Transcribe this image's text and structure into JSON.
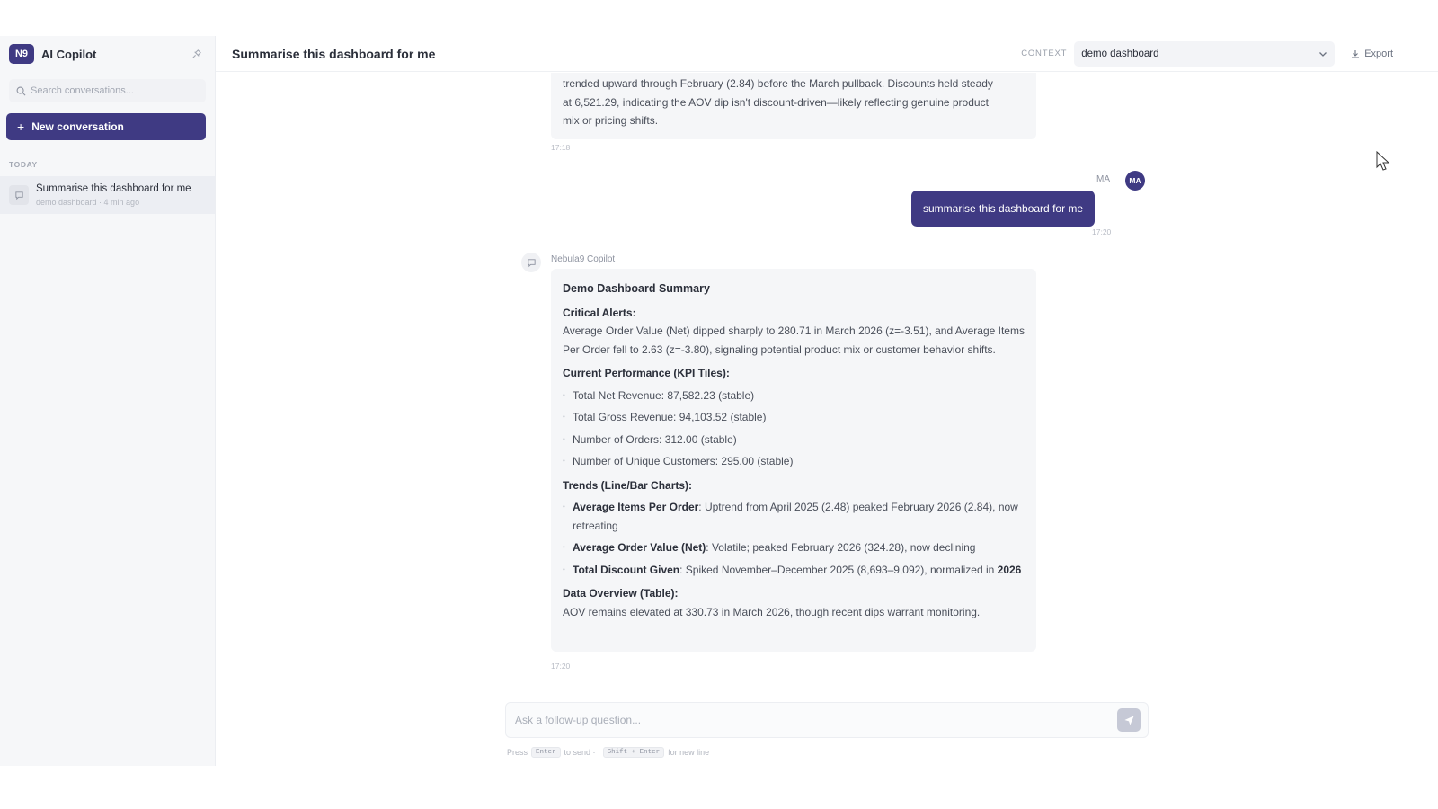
{
  "sidebar": {
    "brand_badge": "N9",
    "brand_name": "AI Copilot",
    "search_placeholder": "Search conversations...",
    "new_conversation_label": "New conversation",
    "section_today": "TODAY",
    "conversations": [
      {
        "title": "Summarise this dashboard for me",
        "meta": "demo dashboard · 4 min ago"
      }
    ]
  },
  "header": {
    "title": "Summarise this dashboard for me",
    "context_label": "CONTEXT",
    "context_value": "demo dashboard",
    "export_label": "Export"
  },
  "chat": {
    "prev_message": {
      "lines": [
        "trended upward through February (2.84) before the March pullback. Discounts held steady",
        "at 6,521.29, indicating the AOV dip isn't discount-driven—likely reflecting genuine product",
        "mix or pricing shifts."
      ],
      "timestamp": "17:18"
    },
    "user_message": {
      "initials": "MA",
      "text": "summarise this dashboard for me",
      "timestamp": "17:20"
    },
    "ai_message": {
      "sender": "Nebula9 Copilot",
      "heading": "Demo Dashboard Summary",
      "critical_title": "Critical Alerts:",
      "critical_text": "Average Order Value (Net) dipped sharply to 280.71 in March 2026 (z=-3.51), and Average Items Per Order fell to 2.63 (z=-3.80), signaling potential product mix or customer behavior shifts.",
      "kpi_title": "Current Performance (KPI Tiles):",
      "kpi_items": [
        "Total Net Revenue: 87,582.23 (stable)",
        "Total Gross Revenue: 94,103.52 (stable)",
        "Number of Orders: 312.00 (stable)",
        "Number of Unique Customers: 295.00 (stable)"
      ],
      "trends_title": "Trends (Line/Bar Charts):",
      "trend_items": [
        {
          "label": "Average Items Per Order",
          "text": ": Uptrend from April 2025 (2.48) peaked February 2026 (2.84), now retreating"
        },
        {
          "label": "Average Order Value (Net)",
          "text": ": Volatile; peaked February 2026 (324.28), now declining"
        },
        {
          "label": "Total Discount Given",
          "text": ": Spiked November–December 2025 (8,693–9,092), normalized in ",
          "bold_tail": "2026"
        }
      ],
      "overview_title": "Data Overview (Table):",
      "overview_text": "AOV remains elevated at 330.73 in March 2026, though recent dips warrant monitoring.",
      "timestamp": "17:20"
    }
  },
  "composer": {
    "placeholder": "Ask a follow-up question...",
    "hint_press": "Press",
    "hint_enter_key": "Enter",
    "hint_to_send": "to send ·",
    "hint_shift_enter_key": "Shift + Enter",
    "hint_new_line": "for new line"
  },
  "colors": {
    "accent": "#3f3a83",
    "sidebar_bg": "#f6f7f9",
    "bubble_bg": "#f5f6f8"
  }
}
